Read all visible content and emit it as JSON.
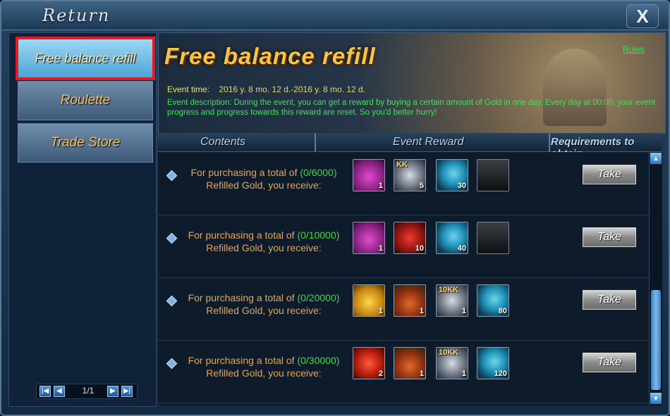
{
  "window": {
    "title": "Return",
    "close_label": "X"
  },
  "sidebar": {
    "items": [
      {
        "label": "Free balance refill",
        "active": true
      },
      {
        "label": "Roulette",
        "active": false
      },
      {
        "label": "Trade Store",
        "active": false
      }
    ],
    "pager": {
      "text": "1/1"
    }
  },
  "banner": {
    "title": "Free balance refill",
    "rules_label": "Rules",
    "event_time_label": "Event time:",
    "event_time_value": "2016 y. 8 mo. 12 d.-2016 y. 8 mo. 12 d.",
    "description": "Event description: During the event, you can get a reward by buying a certain amount of Gold in one day. Every day at 00:00, your event progress and progress towards this reward are reset. So you'd better hurry!"
  },
  "columns": {
    "contents": "Contents",
    "reward": "Event Reward",
    "requirements": "Requirements to obtain"
  },
  "rows": [
    {
      "prefix": "For purchasing a total of",
      "count": "(0/6000)",
      "suffix": "Refilled Gold, you receive:",
      "take": "Take",
      "items": [
        {
          "icon": "gift-box-pink-icon",
          "qty": "1",
          "tag": ""
        },
        {
          "icon": "silver-coin-icon",
          "qty": "5",
          "tag": "KK"
        },
        {
          "icon": "scroll-icon",
          "qty": "30",
          "tag": ""
        },
        {
          "icon": "empty-slot",
          "qty": "",
          "tag": ""
        }
      ]
    },
    {
      "prefix": "For purchasing a total of",
      "count": "(0/10000)",
      "suffix": "Refilled Gold, you receive:",
      "take": "Take",
      "items": [
        {
          "icon": "gift-box-pink-icon",
          "qty": "1",
          "tag": ""
        },
        {
          "icon": "red-potion-icon",
          "qty": "10",
          "tag": ""
        },
        {
          "icon": "scroll-icon",
          "qty": "40",
          "tag": ""
        },
        {
          "icon": "empty-slot",
          "qty": "",
          "tag": ""
        }
      ]
    },
    {
      "prefix": "For purchasing a total of",
      "count": "(0/20000)",
      "suffix": "Refilled Gold, you receive:",
      "take": "Take",
      "items": [
        {
          "icon": "gold-chest-icon",
          "qty": "1",
          "tag": ""
        },
        {
          "icon": "gift-bag-red-icon",
          "qty": "1",
          "tag": ""
        },
        {
          "icon": "silver-coin-icon",
          "qty": "1",
          "tag": "10KK"
        },
        {
          "icon": "scroll-icon",
          "qty": "80",
          "tag": ""
        }
      ]
    },
    {
      "prefix": "For purchasing a total of",
      "count": "(0/30000)",
      "suffix": "Refilled Gold, you receive:",
      "take": "Take",
      "items": [
        {
          "icon": "red-gem-icon",
          "qty": "2",
          "tag": ""
        },
        {
          "icon": "gift-bag-red-icon",
          "qty": "1",
          "tag": ""
        },
        {
          "icon": "silver-coin-icon",
          "qty": "1",
          "tag": "10KK"
        },
        {
          "icon": "scroll-icon",
          "qty": "120",
          "tag": ""
        }
      ]
    }
  ],
  "pager_icons": {
    "first": "first-page-icon",
    "prev": "prev-page-icon",
    "next": "next-page-icon",
    "last": "last-page-icon"
  }
}
